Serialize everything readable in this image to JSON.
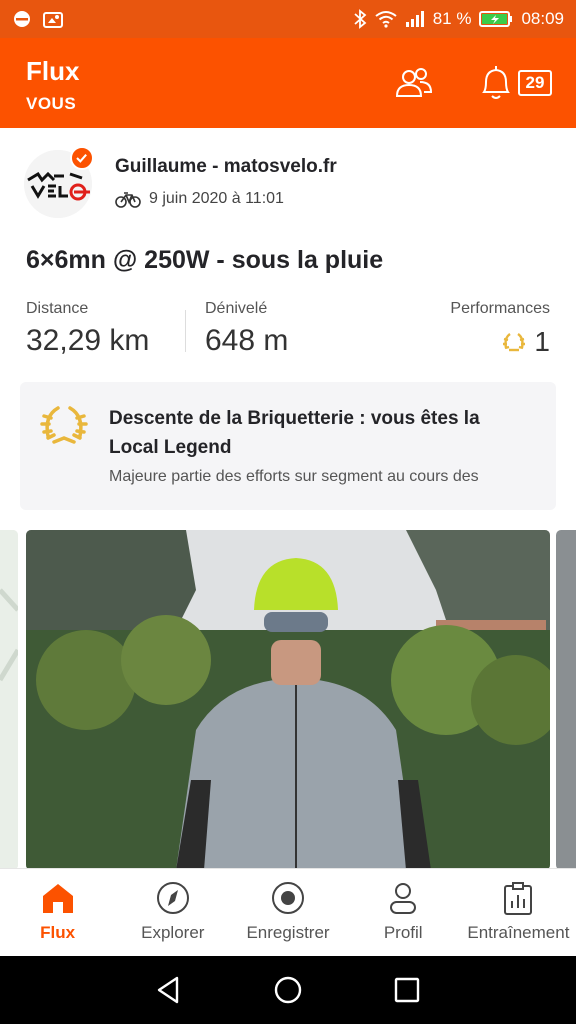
{
  "status": {
    "battery": "81 %",
    "time": "08:09"
  },
  "header": {
    "title": "Flux",
    "subtitle": "VOUS",
    "notification_count": "29"
  },
  "activity": {
    "athlete": "Guillaume - matosvelo.fr",
    "date": "9 juin 2020 à 11:01",
    "title": "6×6mn @ 250W - sous la pluie",
    "stats": [
      {
        "label": "Distance",
        "value": "32,29 km"
      },
      {
        "label": "Dénivelé",
        "value": "648 m"
      },
      {
        "label": "Performances",
        "value": "1"
      }
    ],
    "segment": {
      "title": "Descente de la Briquetterie : vous êtes la Local Legend",
      "description": "Majeure partie des efforts sur segment au cours des"
    }
  },
  "tabs": [
    {
      "label": "Flux",
      "icon": "home-icon"
    },
    {
      "label": "Explorer",
      "icon": "compass-icon"
    },
    {
      "label": "Enregistrer",
      "icon": "record-icon"
    },
    {
      "label": "Profil",
      "icon": "profile-icon"
    },
    {
      "label": "Entraînement",
      "icon": "clipboard-chart-icon"
    }
  ],
  "colors": {
    "accent": "#fc5200",
    "statusbar": "#e8560f",
    "gold": "#e9b73c"
  }
}
